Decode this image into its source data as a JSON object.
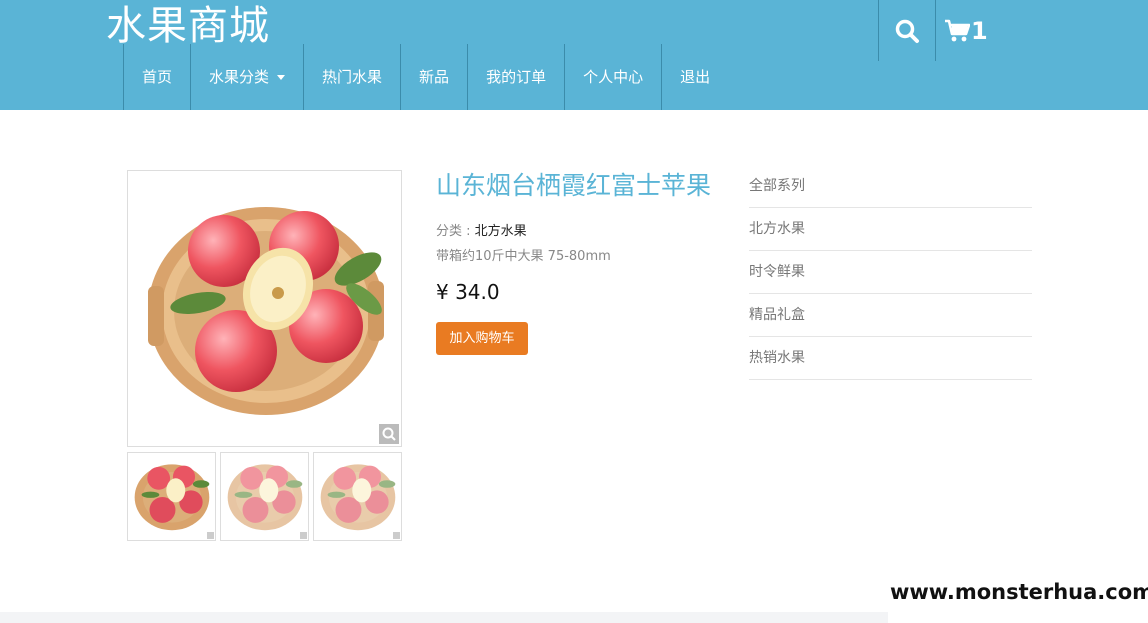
{
  "header": {
    "brand": "水果商城",
    "cart_count": "1",
    "nav": [
      {
        "label": "首页"
      },
      {
        "label": "水果分类"
      },
      {
        "label": "热门水果"
      },
      {
        "label": "新品"
      },
      {
        "label": "我的订单"
      },
      {
        "label": "个人中心"
      },
      {
        "label": "退出"
      }
    ],
    "icons": {
      "search": "search-icon",
      "cart": "cart-icon",
      "dropdown": "caret-down-icon"
    }
  },
  "product": {
    "title": "山东烟台栖霞红富士苹果",
    "category_label": "分类 : ",
    "category_value": "北方水果",
    "description": "带箱约10斤中大果 75-80mm",
    "price": "¥ 34.0",
    "add_to_cart": "加入购物车",
    "images": [
      "apple-basket-main",
      "apple-basket-thumb-1",
      "apple-basket-thumb-2",
      "apple-basket-thumb-3"
    ]
  },
  "sidebar": {
    "items": [
      {
        "label": "全部系列"
      },
      {
        "label": "北方水果"
      },
      {
        "label": "时令鲜果"
      },
      {
        "label": "精品礼盒"
      },
      {
        "label": "热销水果"
      }
    ]
  },
  "watermark": "www.monsterhua.com",
  "colors": {
    "header_bg": "#5ab4d6",
    "accent_button": "#e97b22",
    "title_color": "#5ab4d6"
  }
}
